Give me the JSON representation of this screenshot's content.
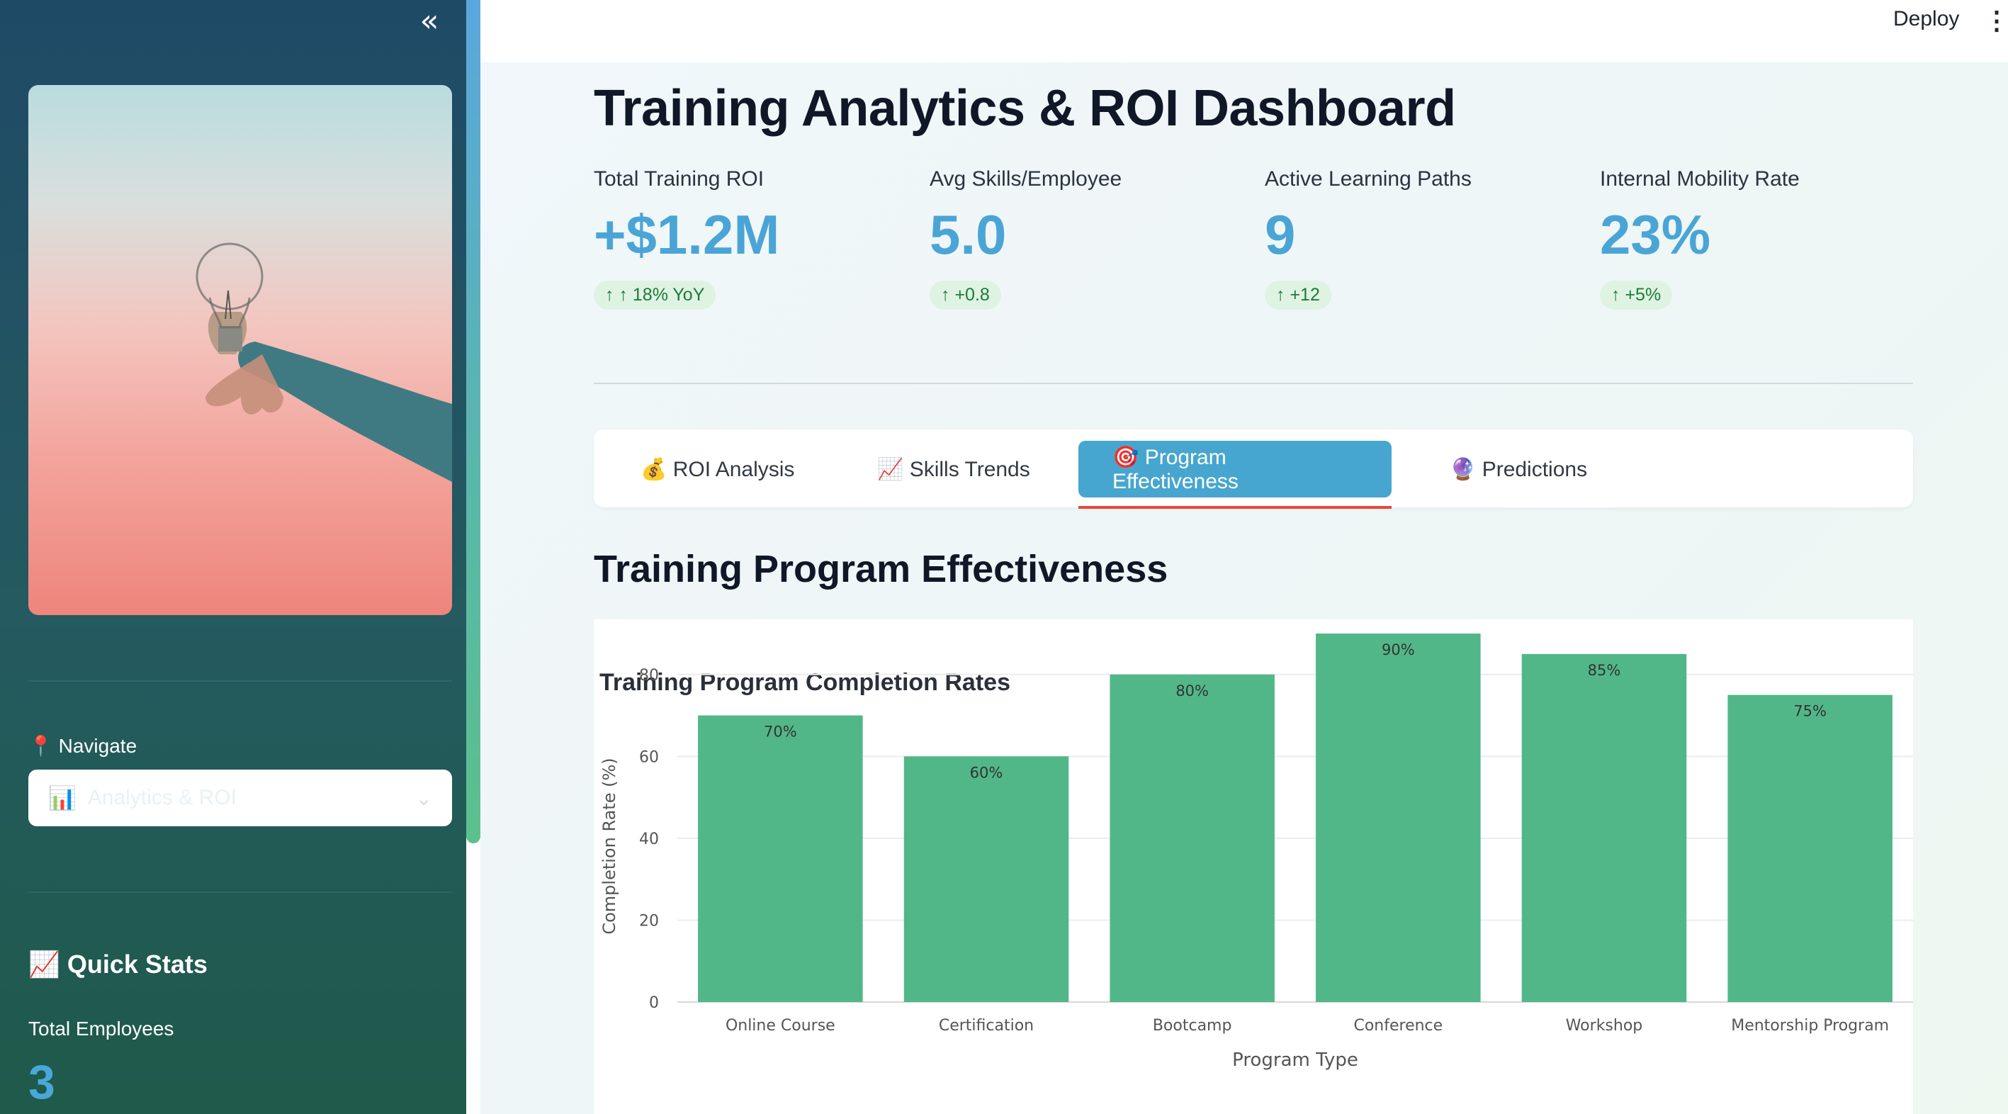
{
  "sidebar": {
    "collapse_icon": "«",
    "navigate_label": "📍 Navigate",
    "nav_select": {
      "icon": "📊",
      "value": "Analytics & ROI"
    },
    "quick_stats_title": "📈 Quick Stats",
    "total_employees_label": "Total Employees",
    "total_employees_value": "3"
  },
  "topbar": {
    "deploy": "Deploy",
    "menu_icon": "⋮"
  },
  "page_title": "Training Analytics & ROI Dashboard",
  "metrics": [
    {
      "label": "Total Training ROI",
      "value": "+$1.2M",
      "delta": "↑ ↑ 18% YoY"
    },
    {
      "label": "Avg Skills/Employee",
      "value": "5.0",
      "delta": "↑ +0.8"
    },
    {
      "label": "Active Learning Paths",
      "value": "9",
      "delta": "↑ +12"
    },
    {
      "label": "Internal Mobility Rate",
      "value": "23%",
      "delta": "↑ +5%"
    }
  ],
  "tabs": [
    {
      "label": "💰 ROI Analysis"
    },
    {
      "label": "📈 Skills Trends"
    },
    {
      "label": "🎯 Program Effectiveness",
      "active": true
    },
    {
      "label": "🔮 Predictions"
    }
  ],
  "section_title": "Training Program Effectiveness",
  "colors": {
    "bar": "#52b788",
    "accent": "#47a6cf",
    "tab_underline": "#e6483a"
  },
  "chart_data": {
    "type": "bar",
    "title": "Training Program Completion Rates",
    "xlabel": "Program Type",
    "ylabel": "Completion Rate (%)",
    "categories": [
      "Online Course",
      "Certification",
      "Bootcamp",
      "Conference",
      "Workshop",
      "Mentorship Program"
    ],
    "values": [
      70,
      60,
      80,
      90,
      85,
      75
    ],
    "data_labels": [
      "70%",
      "60%",
      "80%",
      "90%",
      "85%",
      "75%"
    ],
    "yticks": [
      0,
      20,
      40,
      60,
      80
    ],
    "ylim": [
      0,
      90
    ],
    "grid": true
  }
}
